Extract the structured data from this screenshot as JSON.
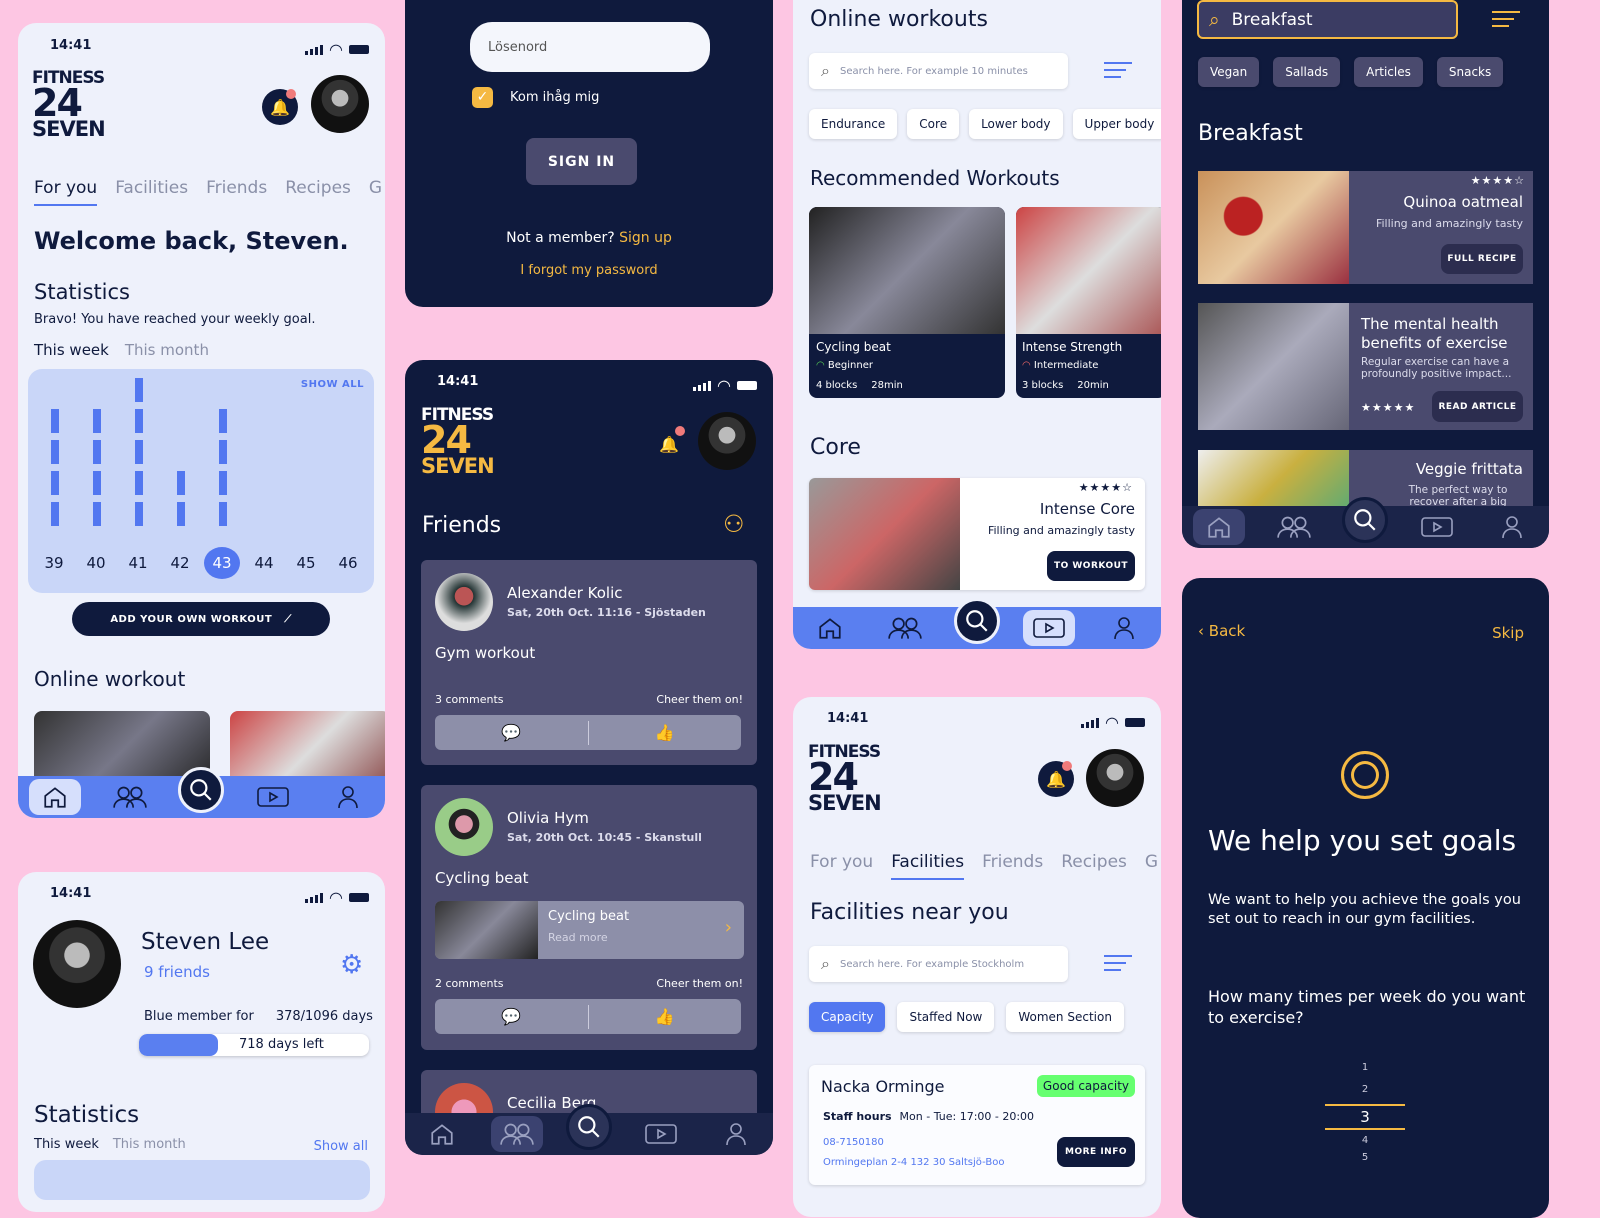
{
  "colors": {
    "background": "#fdc6e3",
    "navy": "#0f1a3d",
    "accent": "#5277f0",
    "yellow": "#f5b942",
    "card_purple": "#4a4a6e",
    "good": "#66ff70"
  },
  "status_time": "14:41",
  "logo": {
    "l1": "FITNESS",
    "l2": "24",
    "l3": "SEVEN"
  },
  "home": {
    "tabs": [
      "For you",
      "Facilities",
      "Friends",
      "Recipes",
      "G"
    ],
    "welcome": "Welcome back, Steven.",
    "stats_title": "Statistics",
    "stats_sub": "Bravo! You have reached your weekly goal.",
    "period": [
      "This week",
      "This month"
    ],
    "show_all": "SHOW ALL",
    "weeks": [
      {
        "w": "39",
        "v": 4
      },
      {
        "w": "40",
        "v": 4
      },
      {
        "w": "41",
        "v": 5
      },
      {
        "w": "42",
        "v": 2
      },
      {
        "w": "43",
        "v": 4,
        "current": true
      },
      {
        "w": "44",
        "v": 0
      },
      {
        "w": "45",
        "v": 0
      },
      {
        "w": "46",
        "v": 0
      }
    ],
    "add_workout": "ADD YOUR OWN WORKOUT",
    "online_title": "Online workout"
  },
  "profile": {
    "name": "Steven Lee",
    "friends": "9 friends",
    "member_label": "Blue member for",
    "member_days": "378/1096 days",
    "progress": 0.345,
    "days_left": "718 days left",
    "stats_title": "Statistics",
    "period": [
      "This week",
      "This month"
    ],
    "show_all": "Show all"
  },
  "login": {
    "password_placeholder": "Lösenord",
    "remember": "Kom ihåg mig",
    "remember_checked": true,
    "sign_in": "SIGN IN",
    "not_member": "Not a member?",
    "sign_up": "Sign up",
    "forgot": "I forgot my password"
  },
  "friends": {
    "title": "Friends",
    "posts": [
      {
        "name": "Alexander Kolic",
        "meta": "Sat, 20th Oct. 11:16 - Sjöstaden",
        "activity": "Gym workout",
        "comments": "3 comments",
        "cheer": "Cheer them on!"
      },
      {
        "name": "Olivia Hym",
        "meta": "Sat, 20th Oct. 10:45 - Skanstull",
        "activity": "Cycling beat",
        "link_title": "Cycling beat",
        "link_sub": "Read more",
        "comments": "2 comments",
        "cheer": "Cheer them on!"
      },
      {
        "name": "Cecilia Berg"
      }
    ]
  },
  "workouts": {
    "title": "Online workouts",
    "search_placeholder": "Search here. For example 10 minutes",
    "chips": [
      "Endurance",
      "Core",
      "Lower body",
      "Upper body"
    ],
    "recommended": "Recommended Workouts",
    "items": [
      {
        "title": "Cycling beat",
        "level": "Beginner",
        "blocks": "4 blocks",
        "time": "28min"
      },
      {
        "title": "Intense Strength",
        "level": "Intermediate",
        "blocks": "3 blocks",
        "time": "20min"
      }
    ],
    "core_title": "Core",
    "core": {
      "rating": "4 of 5",
      "stars": "★★★★☆",
      "title": "Intense Core",
      "sub": "Filling and amazingly tasty",
      "button": "TO WORKOUT"
    }
  },
  "facilities": {
    "tabs": [
      "For you",
      "Facilities",
      "Friends",
      "Recipes",
      "G"
    ],
    "title": "Facilities near you",
    "search_placeholder": "Search here. For example Stockholm",
    "chips": [
      "Capacity",
      "Staffed Now",
      "Women Section"
    ],
    "gym": {
      "name": "Nacka Orminge",
      "badge": "Good capacity",
      "hours_label": "Staff hours",
      "hours": "Mon - Tue: 17:00 - 20:00",
      "phone": "08-7150180",
      "address": "Ormingeplan 2-4 132 30 Saltsjö-Boo",
      "button": "MORE INFO"
    }
  },
  "breakfast": {
    "search_value": "Breakfast",
    "chips": [
      "Vegan",
      "Sallads",
      "Articles",
      "Snacks"
    ],
    "title": "Breakfast",
    "items": [
      {
        "title": "Quinoa oatmeal",
        "sub": "Filling and amazingly tasty",
        "stars": "★★★★☆",
        "button": "FULL RECIPE"
      },
      {
        "title": "The mental health benefits of exercise",
        "sub": "Regular exercise can have a profoundly positive impact...",
        "stars": "★★★★★",
        "button": "READ ARTICLE"
      },
      {
        "title": "Veggie frittata",
        "sub": "The perfect way to recover after a big"
      }
    ]
  },
  "goals": {
    "back": "Back",
    "skip": "Skip",
    "title": "We help you set goals",
    "text": "We want to help you achieve the goals you set out to reach in our gym facilities.",
    "question": "How many times per week do you want to exercise?",
    "picker": [
      "1",
      "2",
      "3",
      "4",
      "5"
    ],
    "selected": "3"
  },
  "nav": [
    "home-icon",
    "friends-icon",
    "search-icon",
    "play-icon",
    "user-icon"
  ]
}
